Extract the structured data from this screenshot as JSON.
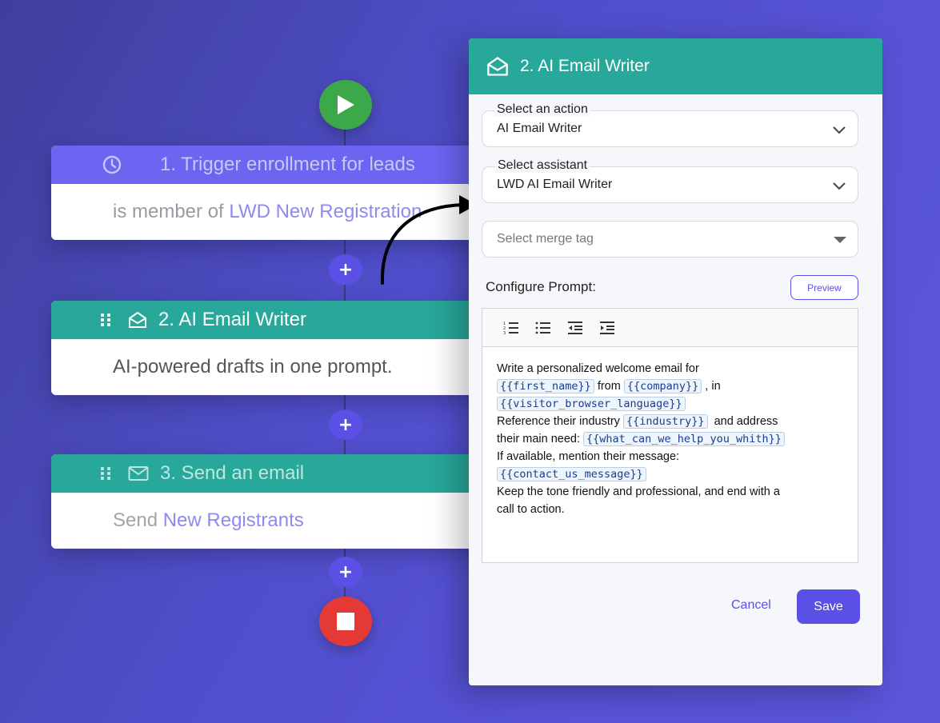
{
  "flow": {
    "step1": {
      "title": "1. Trigger enrollment for leads",
      "body_prefix": "is member of ",
      "body_link": "LWD New Registration"
    },
    "step2": {
      "title": "2. AI Email Writer",
      "body": "AI-powered drafts in one prompt."
    },
    "step3": {
      "title": "3. Send an email",
      "body_prefix": "Send ",
      "body_link": "New Registrants"
    },
    "add_label": "+",
    "icons": {
      "start": "play-icon",
      "stop": "stop-icon",
      "clock": "clock-icon",
      "envelope_open": "envelope-open-icon",
      "envelope": "envelope-icon"
    },
    "colors": {
      "start": "#3ba84a",
      "stop": "#e53935",
      "trigger": "#6b65f2",
      "action": "#27a89a",
      "add": "#5b50e6"
    }
  },
  "panel": {
    "title": "2. AI Email Writer",
    "action_label": "Select an action",
    "action_value": "AI Email Writer",
    "assistant_label": "Select assistant",
    "assistant_value": "LWD AI Email Writer",
    "merge_tag_placeholder": "Select merge tag",
    "prompt_label": "Configure Prompt:",
    "preview_label": "Preview",
    "cancel_label": "Cancel",
    "save_label": "Save",
    "prompt": {
      "l1": "Write a personalized welcome email for",
      "tag_first_name": "{{first_name}}",
      "t_from": "from",
      "tag_company": "{{company}}",
      "t_in": ", in",
      "tag_language": "{{visitor_browser_language}}",
      "l3": "Reference their industry",
      "tag_industry": "{{industry}}",
      "t_and": "and address",
      "l4": "their main need:",
      "tag_need": "{{what_can_we_help_you_whith}}",
      "l5": "If available, mention their message:",
      "tag_message": "{{contact_us_message}}",
      "l6": "Keep the tone friendly and professional, and end with a",
      "l7": "call to action."
    }
  }
}
